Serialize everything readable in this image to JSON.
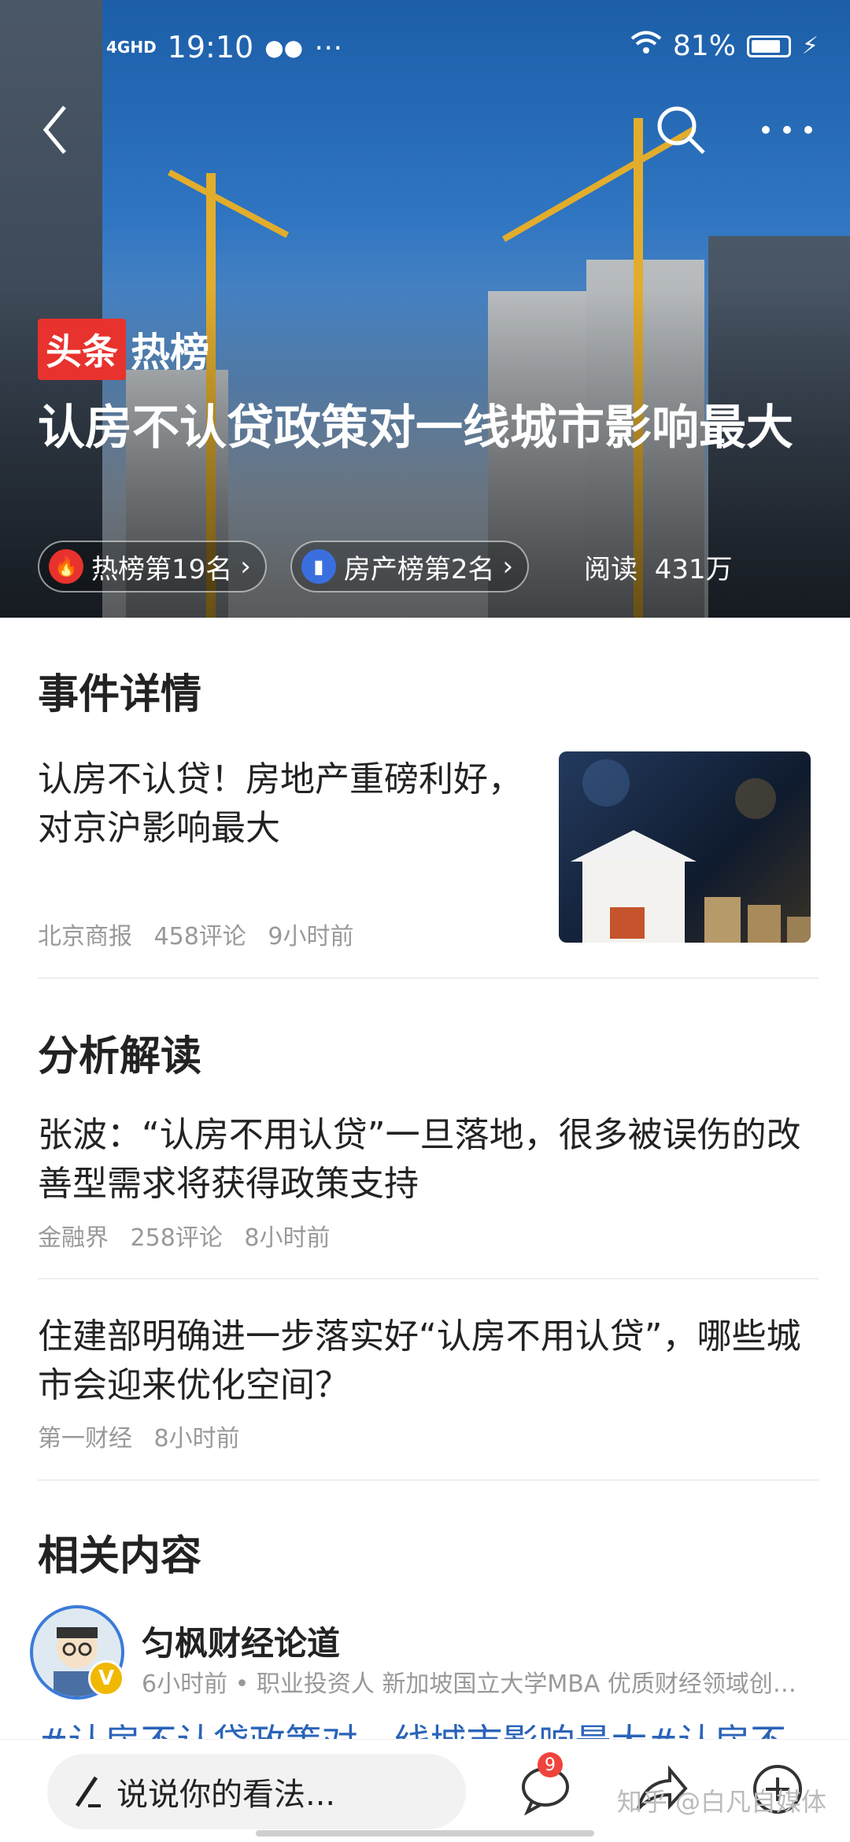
{
  "status_bar": {
    "network": "4GHD",
    "time": "19:10",
    "extras": "⋯",
    "battery_percent_text": "81%",
    "battery_level": 0.81
  },
  "top_nav": {
    "back_icon": "chevron-left-icon",
    "search_icon": "search-icon",
    "more_icon": "more-dots-icon"
  },
  "hero": {
    "brand_tag": "头条",
    "brand_hot": "热榜",
    "headline": "认房不认贷政策对一线城市影响最大",
    "chips": [
      {
        "icon": "flame-icon",
        "label": "热榜第19名",
        "arrow": "›",
        "color": "#e8322d"
      },
      {
        "icon": "building-icon",
        "label": "房产榜第2名",
        "arrow": "›",
        "color": "#3b6fe0"
      }
    ],
    "reads_label": "阅读",
    "reads_value": "431万"
  },
  "sections": {
    "event": {
      "title": "事件详情",
      "article": {
        "title": "认房不认贷！房地产重磅利好，对京沪影响最大",
        "source": "北京商报",
        "comments": "458评论",
        "time": "9小时前"
      }
    },
    "analysis": {
      "title": "分析解读",
      "articles": [
        {
          "title": "张波：“认房不用认贷”一旦落地，很多被误伤的改善型需求将获得政策支持",
          "source": "金融界",
          "comments": "258评论",
          "time": "8小时前"
        },
        {
          "title": "住建部明确进一步落实好“认房不用认贷”，哪些城市会迎来优化空间？",
          "source": "第一财经",
          "time": "8小时前"
        }
      ]
    },
    "related": {
      "title": "相关内容",
      "author": "匀枫财经论道",
      "author_meta": "6小时前 • 职业投资人   新加坡国立大学MBA   优质财经领域创…",
      "snippet": "#认房不认贷政策对一线城市影响最大#认房不"
    }
  },
  "bottom_bar": {
    "comment_placeholder": "说说你的看法...",
    "comment_badge": "9",
    "watermark": "知乎 @白凡自媒体"
  }
}
